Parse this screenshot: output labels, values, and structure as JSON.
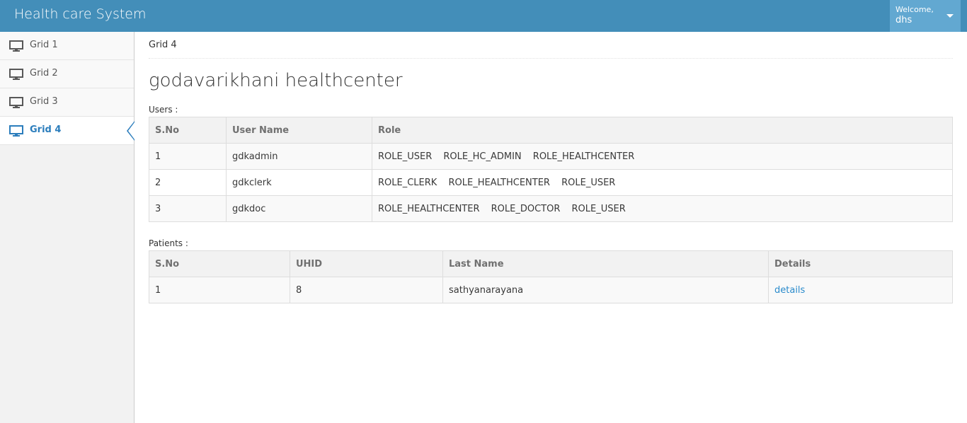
{
  "header": {
    "brand": "Health care System",
    "welcome": "Welcome,",
    "username": "dhs"
  },
  "sidebar": {
    "items": [
      {
        "label": "Grid 1",
        "icon": "desktop-icon"
      },
      {
        "label": "Grid 2",
        "icon": "desktop-icon"
      },
      {
        "label": "Grid 3",
        "icon": "desktop-icon"
      },
      {
        "label": "Grid 4",
        "icon": "desktop-icon",
        "active": true
      }
    ]
  },
  "main": {
    "breadcrumb": "Grid 4",
    "title": "godavarikhani healthcenter",
    "users_label": "Users :",
    "users_table": {
      "headers": [
        "S.No",
        "User Name",
        "Role"
      ],
      "rows": [
        {
          "sno": "1",
          "name": "gdkadmin",
          "roles": [
            "ROLE_USER",
            "ROLE_HC_ADMIN",
            "ROLE_HEALTHCENTER"
          ]
        },
        {
          "sno": "2",
          "name": "gdkclerk",
          "roles": [
            "ROLE_CLERK",
            "ROLE_HEALTHCENTER",
            "ROLE_USER"
          ]
        },
        {
          "sno": "3",
          "name": "gdkdoc",
          "roles": [
            "ROLE_HEALTHCENTER",
            "ROLE_DOCTOR",
            "ROLE_USER"
          ]
        }
      ]
    },
    "patients_label": "Patients :",
    "patients_table": {
      "headers": [
        "S.No",
        "UHID",
        "Last Name",
        "Details"
      ],
      "rows": [
        {
          "sno": "1",
          "uhid": "8",
          "last_name": "sathyanarayana",
          "details": "details"
        }
      ]
    }
  },
  "colors": {
    "navbar": "#438eb9",
    "accent": "#2b7dbc",
    "link": "#2a8bcc"
  }
}
